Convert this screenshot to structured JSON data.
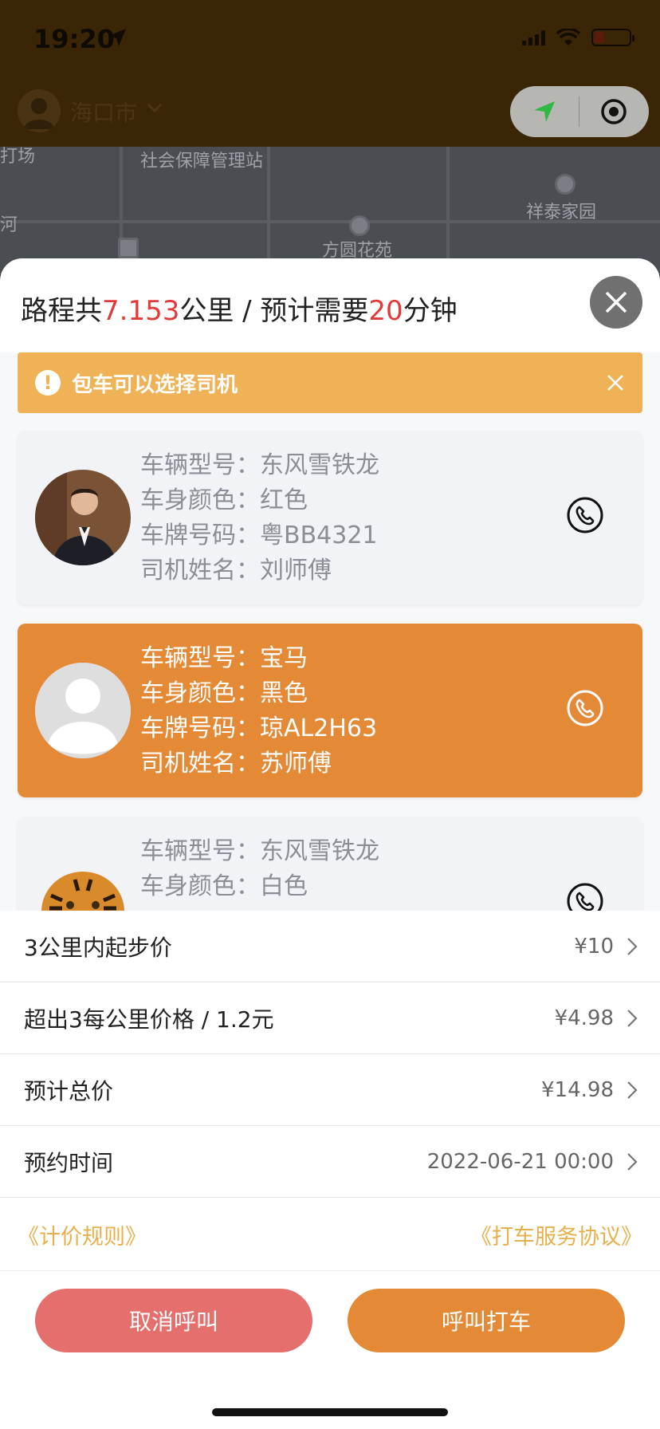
{
  "status_bar": {
    "time": "19:20"
  },
  "header": {
    "city": "海口市"
  },
  "map_labels": {
    "l1": "打场",
    "l2": "社会保障管理站",
    "l3": "祥泰家园",
    "l4": "河",
    "l5": "方圆花苑"
  },
  "route": {
    "prefix": "路程共",
    "distance": "7.153",
    "distance_unit": "公里",
    "separator": " / ",
    "time_prefix": "预计需要",
    "minutes": "20",
    "minutes_unit": "分钟"
  },
  "notice": {
    "text": "包车可以选择司机"
  },
  "labels": {
    "model": "车辆型号：",
    "color": "车身颜色：",
    "plate": "车牌号码：",
    "driver": "司机姓名："
  },
  "drivers": [
    {
      "model": "东风雪铁龙",
      "color": "红色",
      "plate": "粤BB4321",
      "name": "刘师傅",
      "selected": false
    },
    {
      "model": "宝马",
      "color": "黑色",
      "plate": "琼AL2H63",
      "name": "苏师傅",
      "selected": true
    },
    {
      "model": "东风雪铁龙",
      "color": "白色",
      "plate": "",
      "name": "",
      "selected": false
    }
  ],
  "fees": [
    {
      "label": "3公里内起步价",
      "value": "¥10"
    },
    {
      "label": "超出3每公里价格 / 1.2元",
      "value": "¥4.98"
    },
    {
      "label": "预计总价",
      "value": "¥14.98"
    },
    {
      "label": "预约时间",
      "value": "2022-06-21 00:00"
    }
  ],
  "links": {
    "pricing": "《计价规则》",
    "agreement": "《打车服务协议》"
  },
  "buttons": {
    "cancel": "取消呼叫",
    "call": "呼叫打车"
  },
  "colors": {
    "accent": "#e48a36",
    "notice": "#f0b256",
    "cancel": "#e46f6c",
    "highlight_red": "#e23a3a",
    "link": "#e8b04c"
  }
}
